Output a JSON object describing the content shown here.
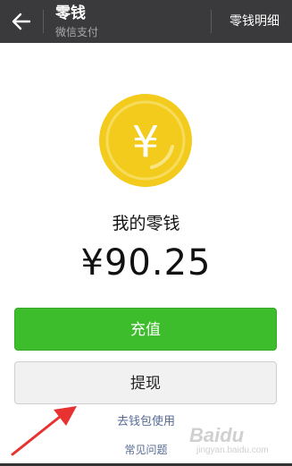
{
  "header": {
    "title": "零钱",
    "subtitle": "微信支付",
    "detail_link": "零钱明细"
  },
  "balance": {
    "label": "我的零钱",
    "amount": "¥90.25",
    "coin_symbol": "¥"
  },
  "buttons": {
    "recharge": "充值",
    "withdraw": "提现"
  },
  "links": {
    "use_wallet": "去钱包使用",
    "faq": "常见问题"
  },
  "watermark": {
    "logo": "Baidu",
    "sub": "jingyan.baidu.com"
  },
  "colors": {
    "topbar": "#3a3a3c",
    "recharge_button": "#3dbd2b",
    "coin": "#f2cb1d",
    "link": "#576b95",
    "arrow": "#e8322f"
  }
}
